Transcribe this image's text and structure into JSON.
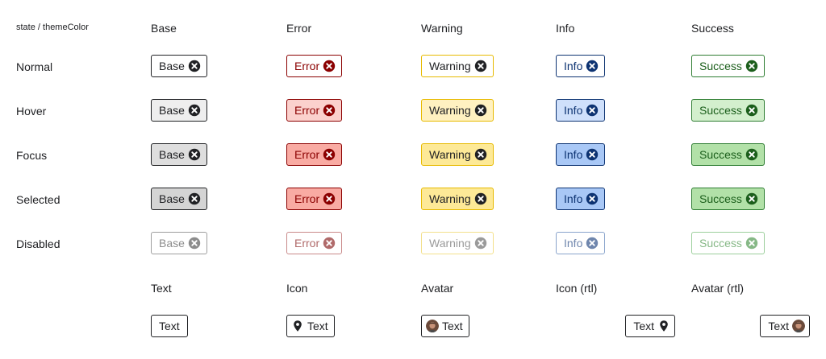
{
  "corner_label": "state / themeColor",
  "themes": [
    {
      "key": "base",
      "label": "Base",
      "fg": "#202124",
      "states": {
        "normal": {
          "bg": "#ffffff",
          "border": "#202124"
        },
        "hover": {
          "bg": "#eeeeee",
          "border": "#202124"
        },
        "focus": {
          "bg": "#dedede",
          "border": "#202124"
        },
        "selected": {
          "bg": "#d4d4d4",
          "border": "#202124"
        },
        "disabled": {
          "bg": "#ffffff",
          "border": "#9e9e9e",
          "fg": "#8c8c8c"
        }
      }
    },
    {
      "key": "error",
      "label": "Error",
      "fg": "#8b0000",
      "states": {
        "normal": {
          "bg": "#ffffff",
          "border": "#8b0000"
        },
        "hover": {
          "bg": "#fbd1cd",
          "border": "#8b0000"
        },
        "focus": {
          "bg": "#f9aba3",
          "border": "#8b0000"
        },
        "selected": {
          "bg": "#f9aba3",
          "border": "#8b0000"
        },
        "disabled": {
          "bg": "#ffffff",
          "border": "#c98a8a",
          "fg": "#b06a6a"
        }
      }
    },
    {
      "key": "warning",
      "label": "Warning",
      "fg": "#202124",
      "states": {
        "normal": {
          "bg": "#ffffff",
          "border": "#e7ba00"
        },
        "hover": {
          "bg": "#fff1c1",
          "border": "#e7ba00"
        },
        "focus": {
          "bg": "#fde997",
          "border": "#e7ba00"
        },
        "selected": {
          "bg": "#fde997",
          "border": "#e7ba00"
        },
        "disabled": {
          "bg": "#ffffff",
          "border": "#f3e08c",
          "fg": "#9a9a9a"
        }
      }
    },
    {
      "key": "info",
      "label": "Info",
      "fg": "#0d3372",
      "states": {
        "normal": {
          "bg": "#ffffff",
          "border": "#0d3372"
        },
        "hover": {
          "bg": "#cfe0fb",
          "border": "#0d3372"
        },
        "focus": {
          "bg": "#a9c8f6",
          "border": "#0d3372"
        },
        "selected": {
          "bg": "#a9c8f6",
          "border": "#0d3372"
        },
        "disabled": {
          "bg": "#ffffff",
          "border": "#8aa4cc",
          "fg": "#6f86ad"
        }
      }
    },
    {
      "key": "success",
      "label": "Success",
      "fg": "#1b5e1b",
      "states": {
        "normal": {
          "bg": "#ffffff",
          "border": "#2e7d32"
        },
        "hover": {
          "bg": "#d3efcd",
          "border": "#2e7d32"
        },
        "focus": {
          "bg": "#b2e1a8",
          "border": "#2e7d32"
        },
        "selected": {
          "bg": "#b2e1a8",
          "border": "#2e7d32"
        },
        "disabled": {
          "bg": "#ffffff",
          "border": "#9ccf9c",
          "fg": "#86b886"
        }
      }
    }
  ],
  "states": [
    {
      "key": "normal",
      "label": "Normal"
    },
    {
      "key": "hover",
      "label": "Hover"
    },
    {
      "key": "focus",
      "label": "Focus"
    },
    {
      "key": "selected",
      "label": "Selected"
    },
    {
      "key": "disabled",
      "label": "Disabled"
    }
  ],
  "variants": {
    "headers": [
      "Text",
      "Icon",
      "Avatar",
      "Icon (rtl)",
      "Avatar (rtl)"
    ],
    "chip_text": "Text"
  },
  "icons": {
    "remove": "close-circle-icon",
    "location": "map-pin-icon",
    "avatar": "user-avatar"
  }
}
